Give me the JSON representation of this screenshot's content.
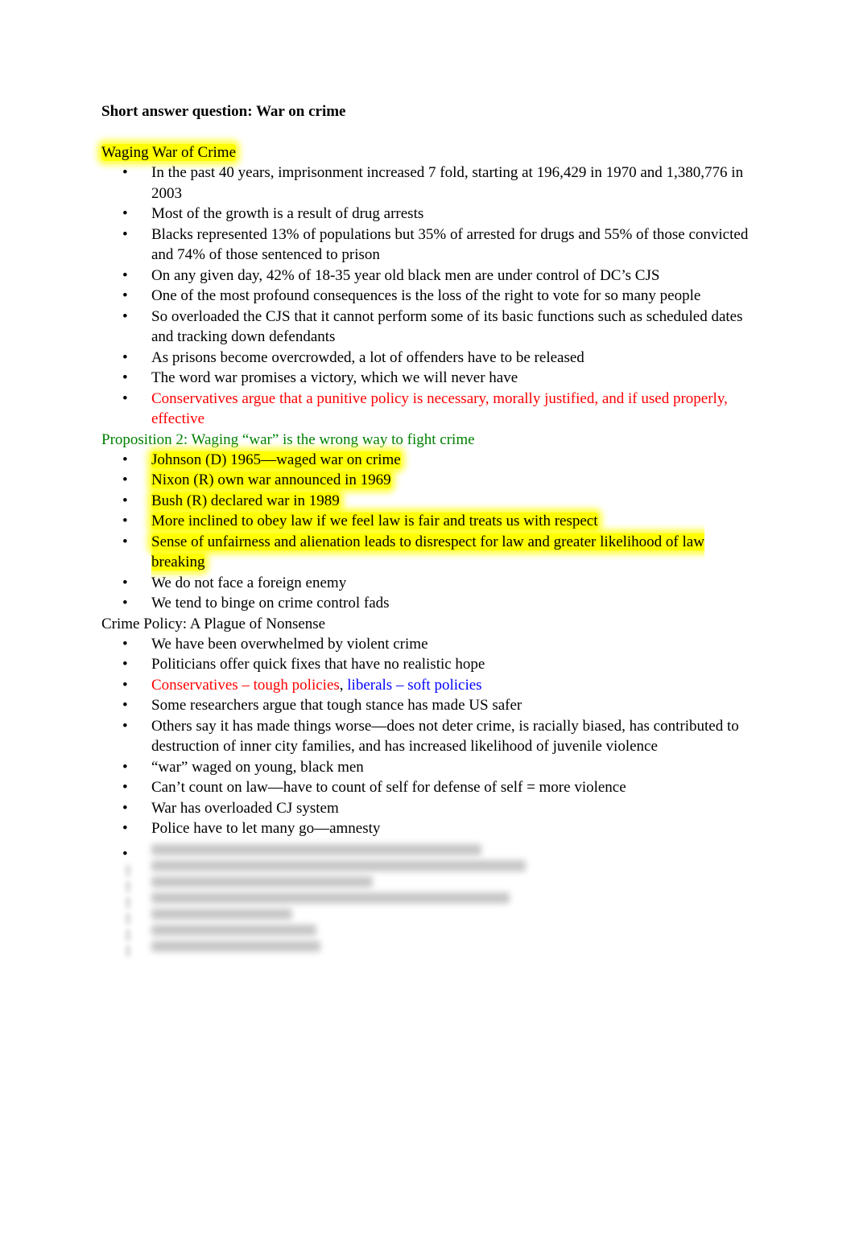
{
  "document": {
    "title": "Short answer question: War on crime",
    "sections": [
      {
        "heading": "Waging War of Crime",
        "heading_style": "highlight",
        "items": [
          {
            "text": "In the past 40 years, imprisonment increased 7 fold, starting at 196,429 in 1970 and 1,380,776 in 2003"
          },
          {
            "text": "Most of the growth is a result of drug arrests"
          },
          {
            "text": "Blacks represented 13% of populations but 35% of arrested for drugs and 55% of those convicted and 74% of those sentenced to prison"
          },
          {
            "text": "On any given day, 42% of 18-35 year old black men are under control of DC’s CJS"
          },
          {
            "text": "One of the most profound consequences is the loss of the right to vote for so many people"
          },
          {
            "text": "So overloaded the CJS that it cannot perform some of its basic functions such as scheduled dates and tracking down defendants"
          },
          {
            "text": "As prisons become overcrowded, a lot of offenders have to be released"
          },
          {
            "text": "The word war promises a victory, which we will never have"
          },
          {
            "text": "Conservatives argue that a punitive policy is necessary, morally justified, and if used properly, effective",
            "color": "red"
          }
        ]
      },
      {
        "heading": "Proposition 2: Waging “war” is the wrong way to fight crime",
        "heading_style": "green",
        "items": [
          {
            "text": "Johnson (D) 1965—waged war on crime",
            "highlight": true
          },
          {
            "text": "Nixon (R) own war announced in 1969",
            "highlight": true
          },
          {
            "text": "Bush (R) declared war in 1989",
            "highlight": true
          },
          {
            "text": "More inclined to obey law if we feel law is fair and treats us with respect",
            "highlight": true
          },
          {
            "text": "Sense of unfairness and alienation leads to disrespect for law and greater likelihood of law breaking",
            "highlight": true
          },
          {
            "text": "We do not face a foreign enemy"
          },
          {
            "text": "We tend to binge on crime control fads"
          }
        ]
      },
      {
        "heading": "Crime Policy: A Plague of Nonsense",
        "heading_style": "plain",
        "items": [
          {
            "text": "We have been overwhelmed by violent crime"
          },
          {
            "text": "Politicians offer quick fixes that have no realistic hope"
          },
          {
            "text_red": "Conservatives – tough policies",
            "separator": ", ",
            "text_blue": "liberals – soft policies"
          },
          {
            "text": "Some researchers argue that tough stance has made US safer"
          },
          {
            "text": "Others say it has made things worse—does not deter crime, is racially biased, has contributed to destruction of inner city families, and has increased likelihood of juvenile violence"
          },
          {
            "text": "“war” waged on young, black men"
          },
          {
            "text": "Can’t count on law—have to count of self for defense of self = more violence"
          },
          {
            "text": "War has overloaded CJ system"
          },
          {
            "text": "Police have to let many go—amnesty"
          }
        ]
      }
    ],
    "bullet_glyph": "•",
    "blurred_note": "remaining content obscured"
  }
}
